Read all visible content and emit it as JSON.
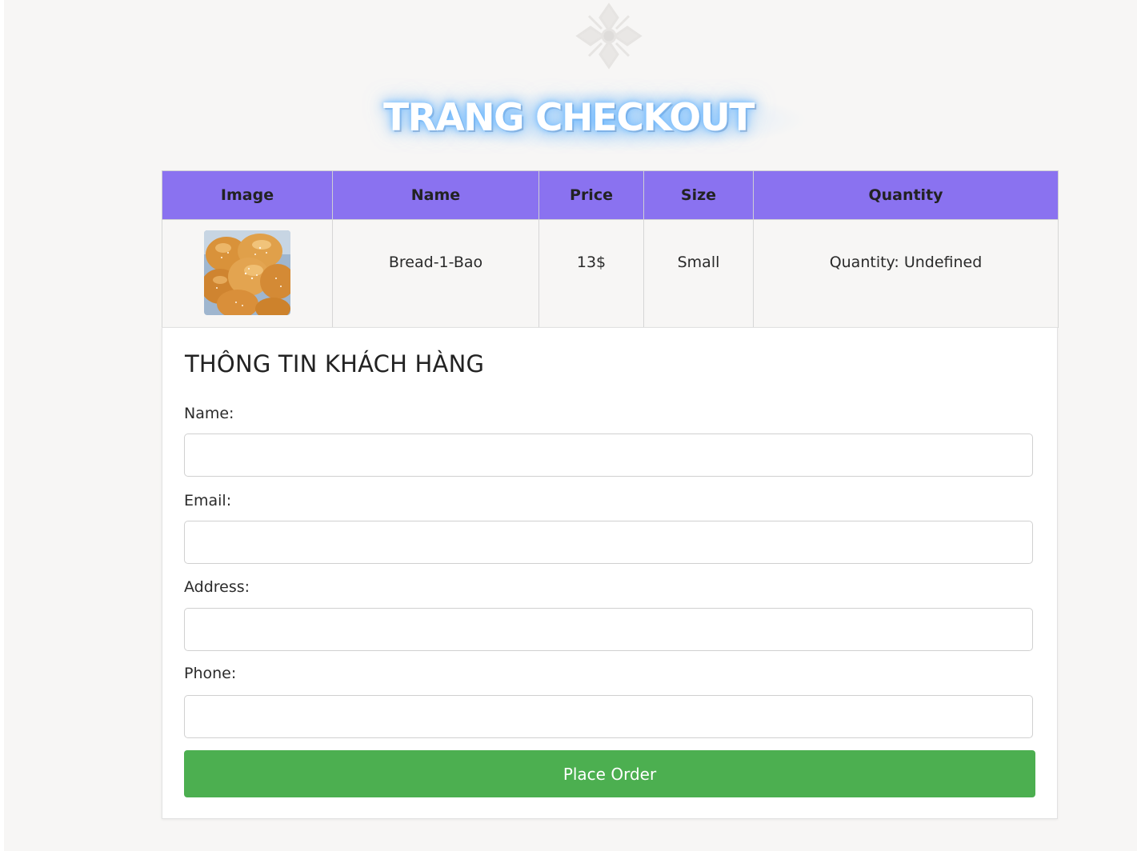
{
  "header": {
    "logo_icon": "ornamental-snowflake-logo",
    "title": "TRANG CHECKOUT"
  },
  "cart_table": {
    "headers": [
      "Image",
      "Name",
      "Price",
      "Size",
      "Quantity"
    ],
    "rows": [
      {
        "image_icon": "bread-buns-photo",
        "name": "Bread-1-Bao",
        "price": "13$",
        "size": "Small",
        "quantity": "Quantity: Undefined"
      }
    ]
  },
  "customer_form": {
    "heading": "THÔNG TIN KHÁCH HÀNG",
    "fields": {
      "name": {
        "label": "Name:",
        "value": ""
      },
      "email": {
        "label": "Email:",
        "value": ""
      },
      "address": {
        "label": "Address:",
        "value": ""
      },
      "phone": {
        "label": "Phone:",
        "value": ""
      }
    },
    "submit_label": "Place Order"
  },
  "colors": {
    "header_row": "#8a72f0",
    "submit_button": "#4caf50",
    "page_background": "#f7f6f5"
  }
}
